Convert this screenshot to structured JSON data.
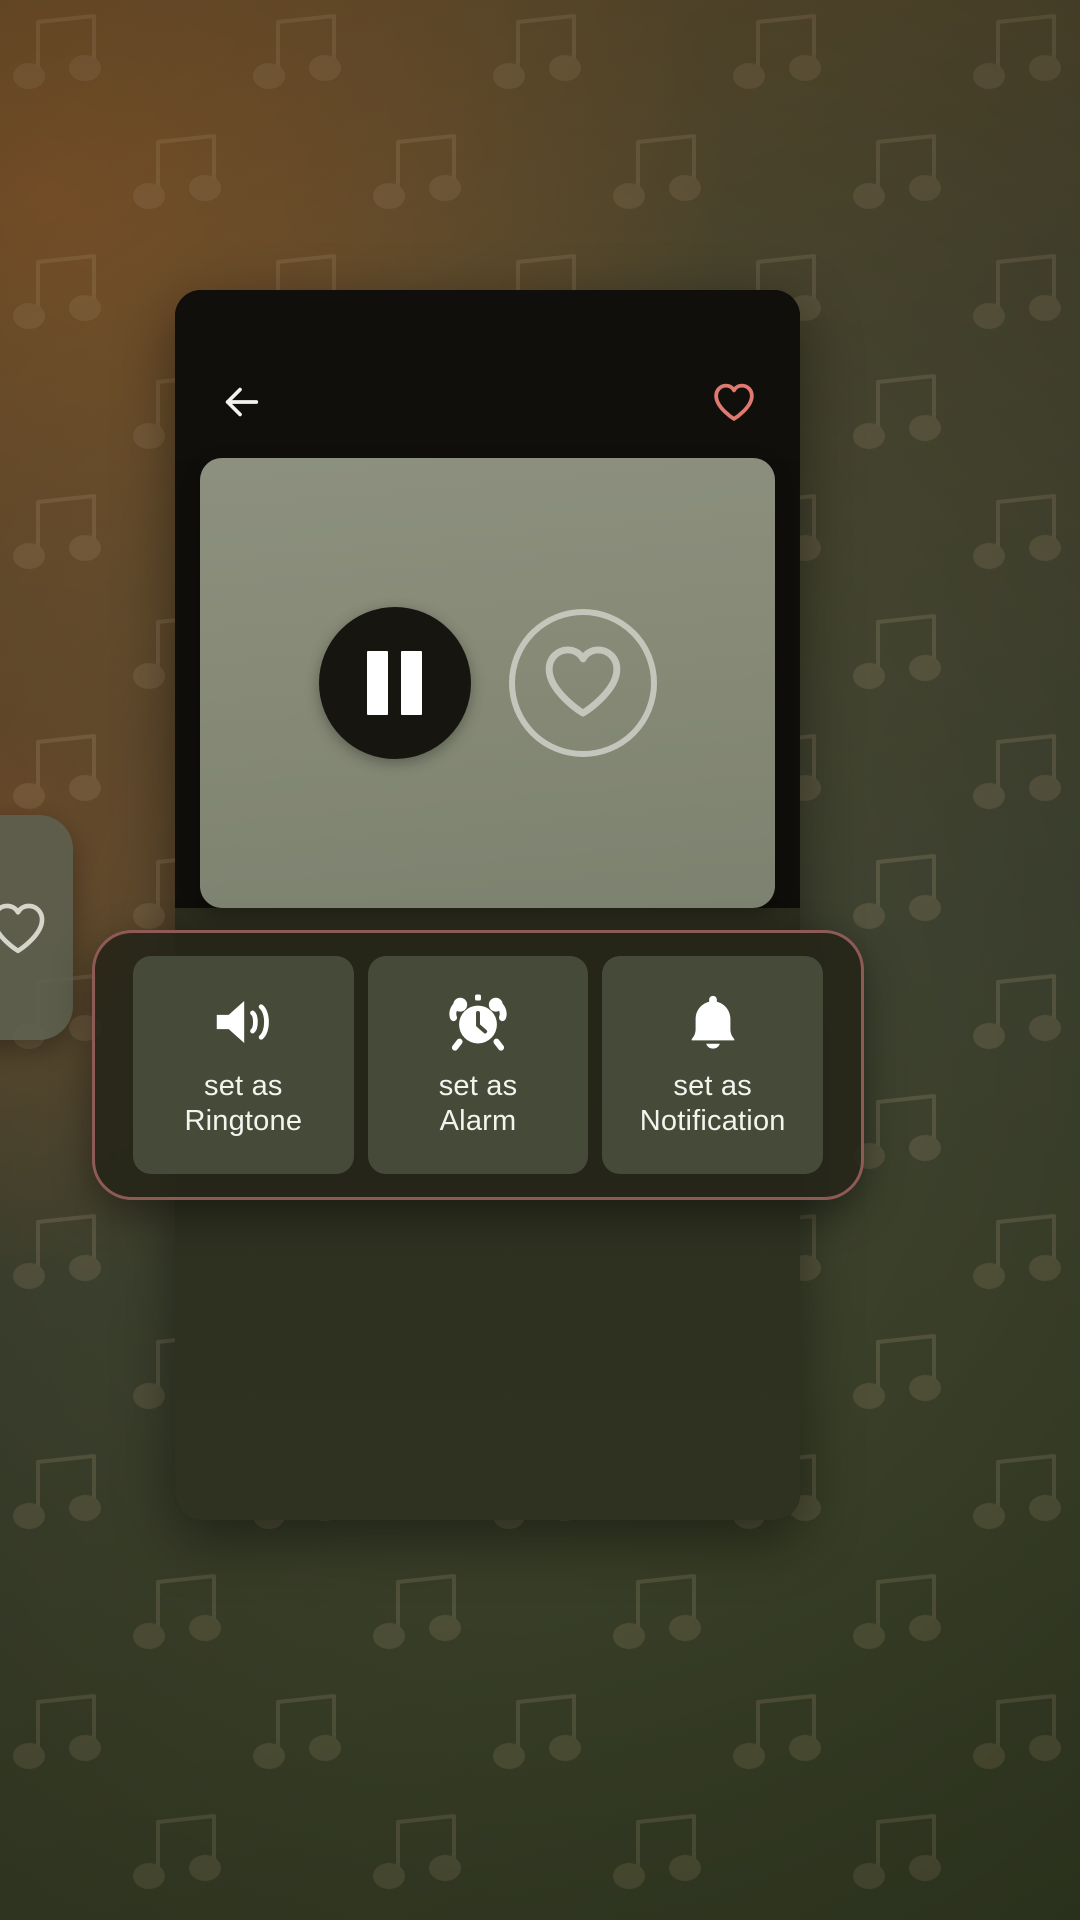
{
  "theme": {
    "bg_gradient_warm": "#8a5c2e",
    "bg_gradient_olive": "#3a4028",
    "sheet_bg": "#110f0c",
    "artwork_bg": "#868a76",
    "panel_border": "#8e5a56",
    "tile_bg": "#464a38",
    "accent_heart": "#e0796f",
    "text_primary": "#f3f4ee"
  },
  "background": {
    "pattern_icon": "music-note-icon",
    "pattern_name": "beamed-eighth-notes"
  },
  "peek_card": {
    "icon": "heart-outline-icon"
  },
  "player": {
    "topbar": {
      "back_icon": "arrow-left-icon",
      "favorite_icon": "heart-outline-icon"
    },
    "artwork": {
      "play_state": "playing",
      "play_pause_icon": "pause-icon",
      "favorite_icon": "heart-outline-icon"
    }
  },
  "actions": {
    "items": [
      {
        "icon": "volume-up-icon",
        "label": "set as\nRingtone"
      },
      {
        "icon": "alarm-clock-icon",
        "label": "set as\nAlarm"
      },
      {
        "icon": "bell-icon",
        "label": "set as\nNotification"
      }
    ]
  }
}
